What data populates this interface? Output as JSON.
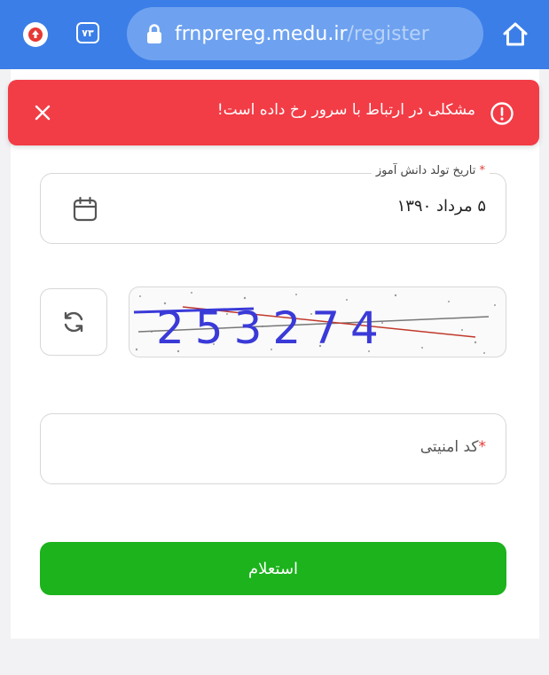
{
  "browser": {
    "tab_count": "۷۳",
    "url_host": "frnprereg.medu.ir",
    "url_path": "/register",
    "colors": {
      "bar": "#3b7ee8",
      "url_box": "#6ea2f0"
    }
  },
  "toast": {
    "message": "مشکلی در ارتباط با سرور رخ داده است!",
    "close_icon": "close-icon",
    "status_icon": "alert-circle-icon",
    "color": "#f23c46"
  },
  "form": {
    "birth_date": {
      "label": "تاریخ تولد دانش آموز",
      "required_mark": "*",
      "value": "۵ مرداد ۱۳۹۰",
      "icon": "calendar-icon"
    },
    "captcha": {
      "text": "253274",
      "refresh_icon": "refresh-icon"
    },
    "security_code": {
      "required_mark": "*",
      "placeholder": "کد امنیتی"
    },
    "submit_label": "استعلام",
    "submit_color": "#1cb31c"
  }
}
